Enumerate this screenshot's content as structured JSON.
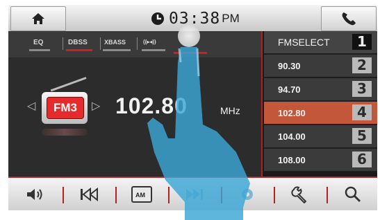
{
  "header": {
    "home_icon": "home-icon",
    "clock_icon": "clock-icon",
    "time": "03:38",
    "ampm": "PM",
    "phone_icon": "phone-icon"
  },
  "modes": {
    "eq": "EQ",
    "dbss": "DBSS",
    "xbass": "XBASS",
    "surround": "((▸◂))",
    "active": "DBSS"
  },
  "radio": {
    "band": "FM3",
    "frequency": "102.80",
    "unit": "MHz"
  },
  "presets": {
    "header_label": "FMSELECT",
    "header_num": "1",
    "items": [
      {
        "freq": "90.30",
        "num": "2",
        "selected": false
      },
      {
        "freq": "94.70",
        "num": "3",
        "selected": false
      },
      {
        "freq": "102.80",
        "num": "4",
        "selected": true
      },
      {
        "freq": "104.00",
        "num": "5",
        "selected": false
      },
      {
        "freq": "108.00",
        "num": "6",
        "selected": false
      }
    ]
  },
  "toolbar": {
    "am_label": "AM"
  },
  "colors": {
    "accent": "#b32020",
    "selected_preset": "#c2573a",
    "hand": "#3aa6d6"
  }
}
